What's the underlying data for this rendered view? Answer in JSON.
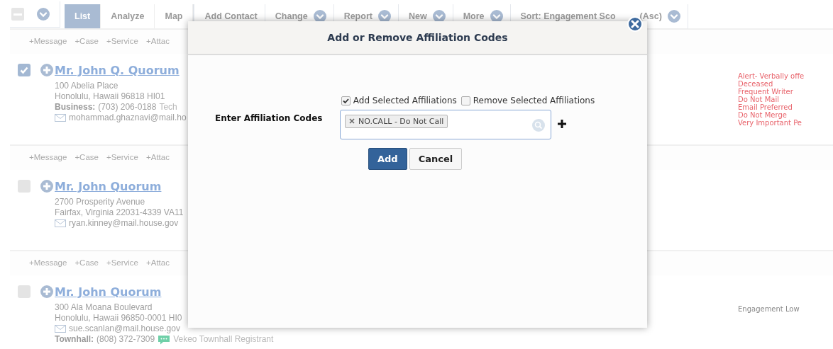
{
  "toolbar": [
    {
      "kind": "checkbox",
      "checked": false
    },
    {
      "kind": "menu"
    },
    {
      "kind": "tab",
      "label": "List",
      "selected": true
    },
    {
      "kind": "tab",
      "label": "Analyze",
      "selected": false
    },
    {
      "kind": "tab",
      "label": "Map",
      "selected": false
    },
    {
      "kind": "button",
      "label": "Add Contact",
      "dropdown": false
    },
    {
      "kind": "button",
      "label": "Change",
      "dropdown": true
    },
    {
      "kind": "button",
      "label": "Report",
      "dropdown": true
    },
    {
      "kind": "button",
      "label": "New",
      "dropdown": true
    },
    {
      "kind": "button",
      "label": "More",
      "dropdown": true
    },
    {
      "kind": "button",
      "label": "Sort: Engagement Sco",
      "tail": "(Asc)",
      "dropdown": true
    }
  ],
  "records": [
    {
      "actions": [
        "+Message",
        "+Case",
        "+Service",
        "+Attac"
      ],
      "checked": true,
      "name": "Mr. John Q. Quorum",
      "lines": [
        {
          "kind": "text",
          "text": "100 Abelia Place"
        },
        {
          "kind": "text",
          "text": "Honolulu, Hawaii 96818 HI01"
        },
        {
          "kind": "phone",
          "label": "Business:",
          "number": "(703) 206-0188",
          "note": "Tech"
        },
        {
          "kind": "email",
          "text": "mohammad.ghaznavi@mail.ho"
        }
      ],
      "tags": [
        {
          "text": "Alert- Verbally offe",
          "color": "#e8636b"
        },
        {
          "text": "Deceased",
          "color": "#e8636b"
        },
        {
          "text": "Frequent Writer",
          "color": "#e8636b"
        },
        {
          "text": "Do Not Mail",
          "color": "#e8636b"
        },
        {
          "text": "Email Preferred",
          "color": "#e8636b"
        },
        {
          "text": "Do Not Merge",
          "color": "#e8636b"
        },
        {
          "text": "Very Important Pe",
          "color": "#e8636b"
        }
      ]
    },
    {
      "actions": [
        "+Message",
        "+Case",
        "+Service",
        "+Attac"
      ],
      "checked": false,
      "name": "Mr. John Quorum",
      "lines": [
        {
          "kind": "text",
          "text": "2700 Prosperity Avenue"
        },
        {
          "kind": "text",
          "text": "Fairfax, Virginia 22031-4339 VA11"
        },
        {
          "kind": "email",
          "text": "ryan.kinney@mail.house.gov"
        }
      ]
    },
    {
      "actions": [
        "+Message",
        "+Case",
        "+Service",
        "+Attac"
      ],
      "checked": false,
      "name": "Mr. John Quorum",
      "lines": [
        {
          "kind": "text",
          "text": "300 Ala Moana Boulevard"
        },
        {
          "kind": "text",
          "text": "Honolulu, Hawaii 96850-0001 HI0"
        },
        {
          "kind": "email",
          "text": "sue.scanlan@mail.house.gov"
        },
        {
          "kind": "chat-phone",
          "label": "Townhall:",
          "number": "(808) 372-7309",
          "note": "Vekeo Townhall Registrant"
        }
      ],
      "tags": [
        {
          "text": "Engagement Low",
          "color": "#888888"
        }
      ]
    }
  ],
  "dialog": {
    "title": "Add or Remove Affiliation Codes",
    "options": [
      {
        "label": "Add Selected Affiliations",
        "checked": true
      },
      {
        "label": "Remove Selected Affiliations",
        "checked": false
      }
    ],
    "field_label": "Enter Affiliation Codes",
    "chips": [
      "NO.CALL - Do Not Call"
    ],
    "buttons": [
      {
        "label": "Add",
        "kind": "primary"
      },
      {
        "label": "Cancel",
        "kind": "secondary"
      }
    ]
  }
}
